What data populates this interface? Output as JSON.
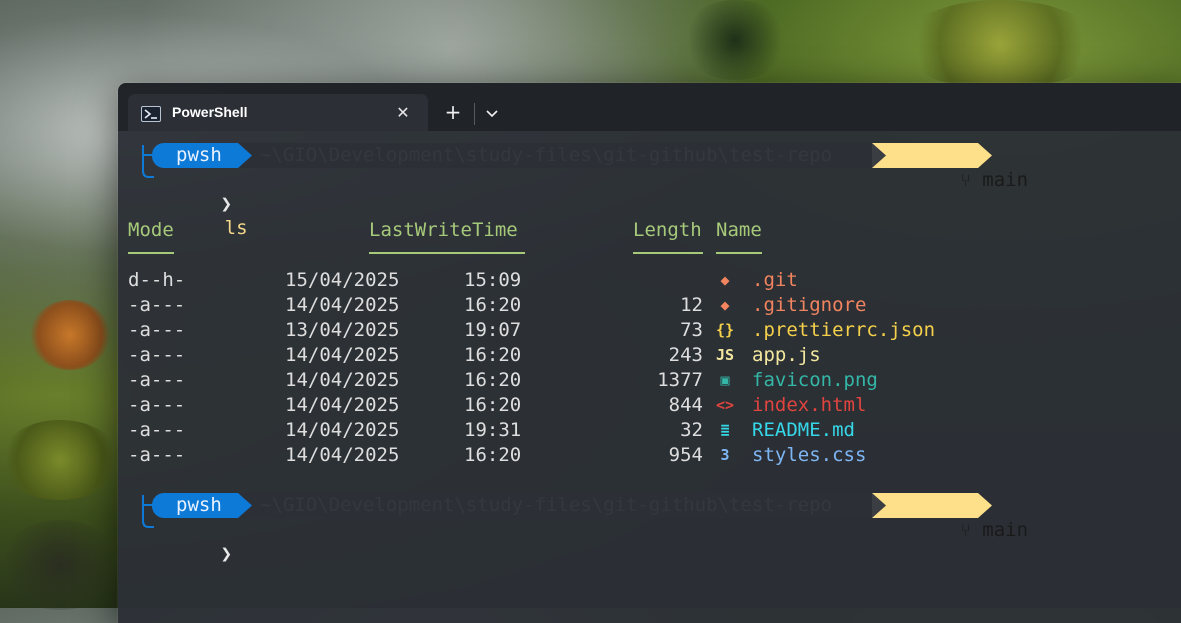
{
  "window": {
    "tab_title": "PowerShell",
    "tab_close": "✕",
    "tab_add": "+",
    "tab_dropdown": "⌄"
  },
  "prompt": {
    "shell": "pwsh",
    "path": "~\\GIO\\Development\\study-files\\git-github\\test-repo",
    "branch_icon": "",
    "branch": "main",
    "symbol": "❯",
    "command": "ls"
  },
  "table": {
    "headers": {
      "mode": "Mode",
      "time": "LastWriteTime",
      "length": "Length",
      "name": "Name"
    },
    "rows": [
      {
        "mode": "d--h-",
        "date": "15/04/2025",
        "time": "15:09",
        "length": "",
        "name": ".git",
        "icon": "git-folder-icon",
        "color": "#f2845f"
      },
      {
        "mode": "-a---",
        "date": "14/04/2025",
        "time": "16:20",
        "length": "12",
        "name": ".gitignore",
        "icon": "git-icon",
        "color": "#f2845f"
      },
      {
        "mode": "-a---",
        "date": "13/04/2025",
        "time": "19:07",
        "length": "73",
        "name": ".prettierrc.json",
        "icon": "json-icon",
        "color": "#f5d04a"
      },
      {
        "mode": "-a---",
        "date": "14/04/2025",
        "time": "16:20",
        "length": "243",
        "name": "app.js",
        "icon": "javascript-icon",
        "color": "#f3e7a0"
      },
      {
        "mode": "-a---",
        "date": "14/04/2025",
        "time": "16:20",
        "length": "1377",
        "name": "favicon.png",
        "icon": "image-icon",
        "color": "#34b7a7"
      },
      {
        "mode": "-a---",
        "date": "14/04/2025",
        "time": "16:20",
        "length": "844",
        "name": "index.html",
        "icon": "html-icon",
        "color": "#e0443e"
      },
      {
        "mode": "-a---",
        "date": "14/04/2025",
        "time": "19:31",
        "length": "32",
        "name": "README.md",
        "icon": "markdown-icon",
        "color": "#35d7e8"
      },
      {
        "mode": "-a---",
        "date": "14/04/2025",
        "time": "16:20",
        "length": "954",
        "name": "styles.css",
        "icon": "css-icon",
        "color": "#7eb6f4"
      }
    ]
  },
  "colors": {
    "pwsh_segment": "#0e7ad8",
    "path_segment": "#3a3d42",
    "git_segment": "#ffe08a",
    "header": "#a6c97a",
    "prompt_connector": "#0e7ad8"
  }
}
